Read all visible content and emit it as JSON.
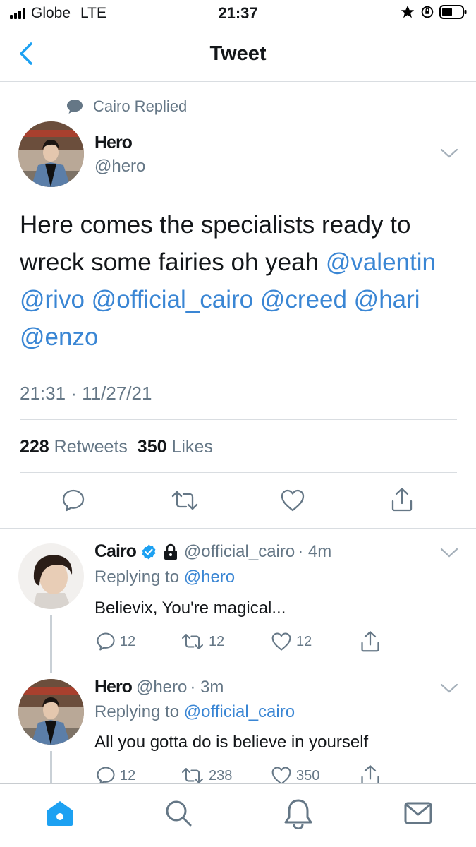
{
  "status_bar": {
    "carrier": "Globe",
    "network": "LTE",
    "time": "21:37"
  },
  "nav": {
    "title": "Tweet"
  },
  "tweet": {
    "context": "Cairo Replied",
    "author_name": "Hero",
    "author_handle": "@hero",
    "text_plain": "Here comes the specialists ready to wreck some fairies oh yeah",
    "mentions": [
      "@valentin",
      "@rivo",
      "@official_cairo",
      "@creed",
      "@hari",
      "@enzo"
    ],
    "timestamp": "21:31 · 11/27/21",
    "retweets_count": "228",
    "retweets_label": "Retweets",
    "likes_count": "350",
    "likes_label": "Likes"
  },
  "replies": [
    {
      "name": "Cairo",
      "handle": "@official_cairo",
      "time": "· 4m",
      "replying_label": "Replying to",
      "replying_to": "@hero",
      "text": "Believix, You're magical...",
      "reply_count": "12",
      "retweet_count": "12",
      "like_count": "12"
    },
    {
      "name": "Hero",
      "handle": "@hero",
      "time": "· 3m",
      "replying_label": "Replying to",
      "replying_to": "@official_cairo",
      "text": "All you gotta do is believe in yourself",
      "reply_count": "12",
      "retweet_count": "238",
      "like_count": "350"
    }
  ],
  "colors": {
    "accent": "#1da1f2",
    "mention": "#3a86d4",
    "muted": "#657786",
    "verified": "#1da1f2"
  },
  "icons": [
    "back-chevron-icon",
    "reply-icon",
    "retweet-icon",
    "like-icon",
    "share-icon",
    "verified-icon",
    "lock-icon",
    "home-icon",
    "search-icon",
    "notifications-icon",
    "messages-icon"
  ]
}
